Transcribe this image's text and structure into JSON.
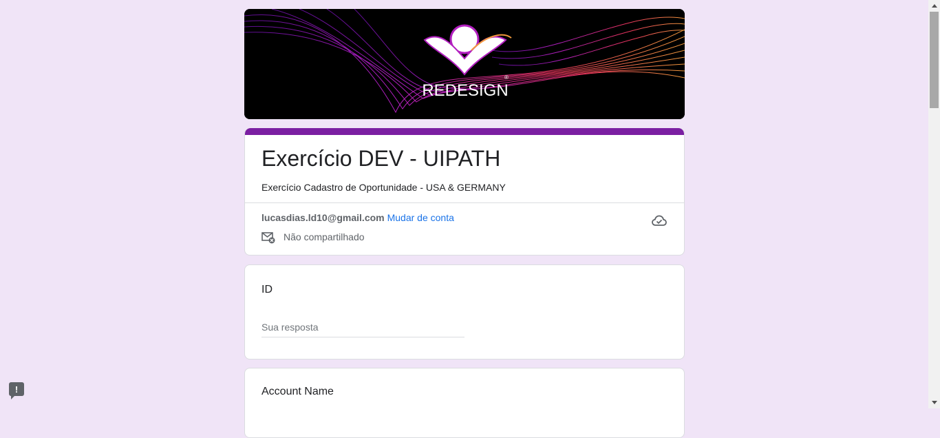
{
  "banner": {
    "logo_text": "REDESIGN"
  },
  "form": {
    "title": "Exercício DEV - UIPATH",
    "description": "Exercício Cadastro de Oportunidade - USA & GERMANY",
    "account_email": "lucasdias.ld10@gmail.com",
    "switch_account": "Mudar de conta",
    "share_status": "Não compartilhado"
  },
  "questions": [
    {
      "label": "ID",
      "placeholder": "Sua resposta"
    },
    {
      "label": "Account Name"
    }
  ],
  "icons": {
    "cloud": "cloud-check-icon",
    "share": "mail-not-shared-icon",
    "feedback": "report-feedback-icon"
  },
  "colors": {
    "page_bg": "#f0e4f7",
    "accent": "#7b1fa2",
    "link": "#1a73e8"
  }
}
